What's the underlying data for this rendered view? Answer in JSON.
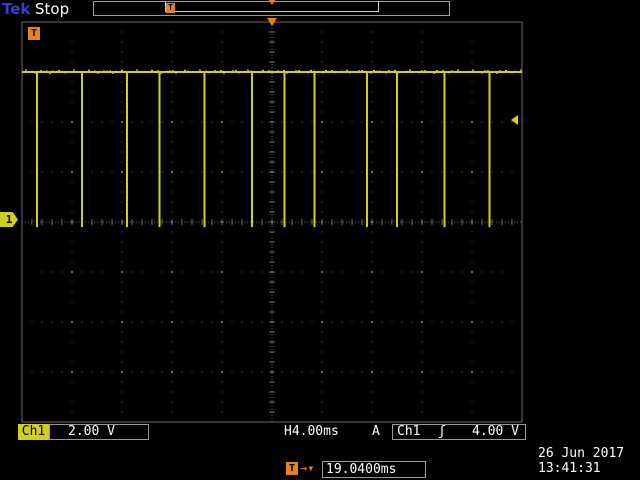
{
  "header": {
    "brand": "Tek",
    "acquisition_status": "Stop"
  },
  "markers": {
    "trigger_position_symbol": "T",
    "channel_ground_label": "1"
  },
  "trace": {
    "color": "#e8e000",
    "high_level_div": -3.0,
    "low_level_div": -0.1,
    "dropout_positions_div": [
      0.3,
      1.2,
      2.1,
      2.75,
      3.65,
      4.6,
      5.25,
      5.85,
      6.9,
      7.5,
      8.45,
      9.35
    ]
  },
  "footer": {
    "channel_label": "Ch1",
    "channel_scale": "2.00 V",
    "horizontal_scale": "H4.00ms",
    "trigger_mode": "A",
    "trigger_source": "Ch1",
    "trigger_slope_symbol": "ʃ",
    "trigger_level": "4.00 V",
    "offset_icon": "T",
    "offset_arrow": "→▾",
    "horizontal_offset": "19.0400ms",
    "date": "26 Jun  2017",
    "time": "13:41:31"
  },
  "colors": {
    "trace": "#d4cf1a",
    "trigger": "#e8821e",
    "brand": "#3a3ad0",
    "grid": "#6a6a6a"
  }
}
